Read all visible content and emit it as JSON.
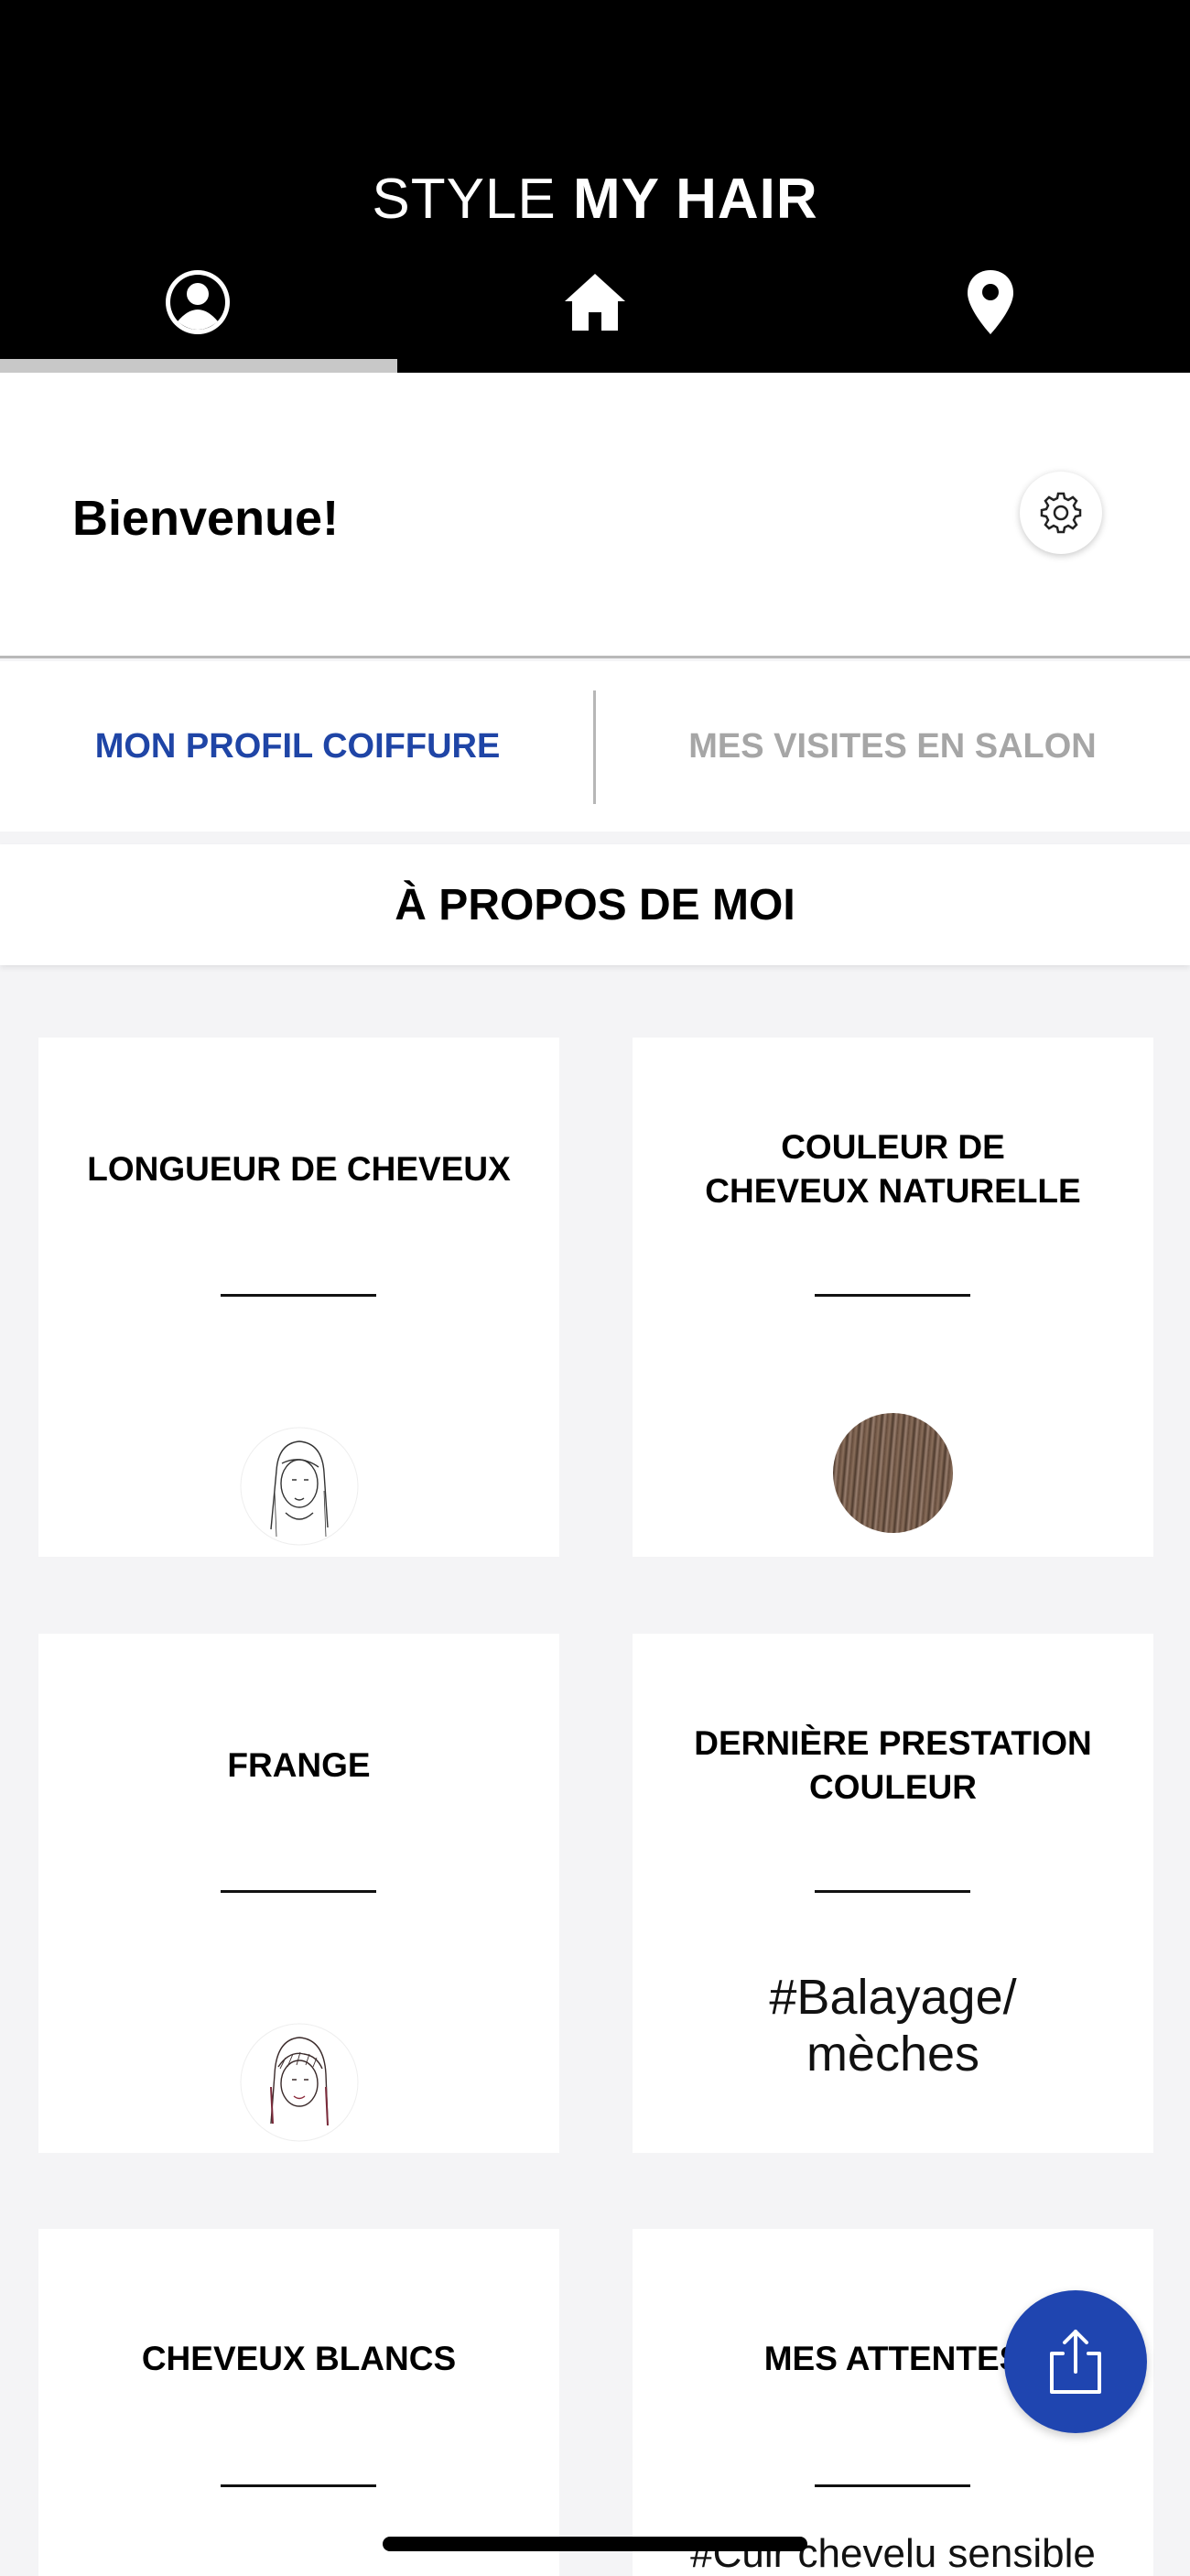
{
  "header": {
    "brand_light": "STYLE",
    "brand_bold": "MY HAIR",
    "tabs": [
      {
        "icon": "profile-icon",
        "active": true
      },
      {
        "icon": "home-icon",
        "active": false
      },
      {
        "icon": "location-pin-icon",
        "active": false
      }
    ]
  },
  "welcome": {
    "title": "Bienvenue!",
    "settings_icon": "gear-icon"
  },
  "segments": {
    "active_label": "MON PROFIL COIFFURE",
    "inactive_label": "MES VISITES EN SALON"
  },
  "section": {
    "title": "À PROPOS DE MOI"
  },
  "cards": [
    {
      "title": "LONGUEUR DE CHEVEUX",
      "visual": "long-hair-avatar"
    },
    {
      "title_line1": "COULEUR DE",
      "title_line2": "CHEVEUX NATURELLE",
      "visual": "hair-color-swatch"
    },
    {
      "title": "FRANGE",
      "visual": "fringe-avatar"
    },
    {
      "title_line1": "DERNIÈRE PRESTATION",
      "title_line2": "COULEUR",
      "value_line1": "#Balayage/",
      "value_line2": "mèches"
    },
    {
      "title": "CHEVEUX BLANCS"
    },
    {
      "title": "MES ATTENTES",
      "value": "#Cuir chevelu sensible"
    }
  ],
  "fab": {
    "icon": "share-icon"
  },
  "colors": {
    "header_bg": "#000000",
    "accent_blue": "#1f45a6",
    "inactive_gray": "#a6a6a6",
    "page_bg": "#f4f4f6"
  }
}
